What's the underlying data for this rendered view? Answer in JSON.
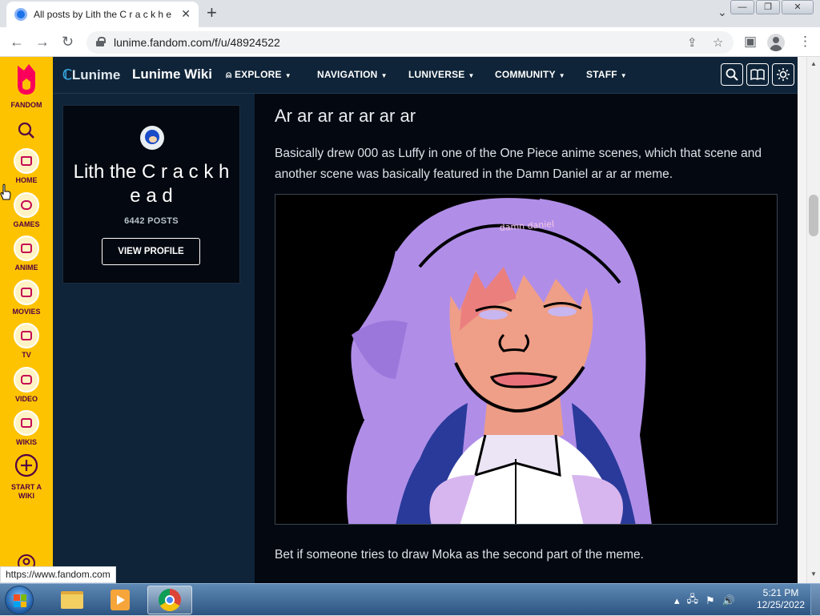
{
  "browser": {
    "tab_title": "All posts by Lith the C r a c k h e",
    "tab_close": "✕",
    "new_tab": "+",
    "url": "lunime.fandom.com/f/u/48924522",
    "status_url": "https://www.fandom.com"
  },
  "window_controls": {
    "minimize": "—",
    "restore": "❐",
    "close": "✕"
  },
  "fandom_rail": {
    "brand": "FANDOM",
    "items": [
      {
        "label": "HOME"
      },
      {
        "label": "GAMES"
      },
      {
        "label": "ANIME"
      },
      {
        "label": "MOVIES"
      },
      {
        "label": "TV"
      },
      {
        "label": "VIDEO"
      },
      {
        "label": "WIKIS"
      },
      {
        "label": "START A WIKI"
      }
    ]
  },
  "wiki_header": {
    "logo": "Lunime",
    "wiki_name": "Lunime Wiki",
    "nav": [
      "EXPLORE",
      "NAVIGATION",
      "LUNIVERSE",
      "COMMUNITY",
      "STAFF"
    ]
  },
  "profile": {
    "name": "Lith the C r a c k h e a d",
    "posts": "6442 POSTS",
    "button": "VIEW PROFILE"
  },
  "post": {
    "title": "Ar ar ar ar ar ar ar",
    "body": "Basically drew 000 as Luffy in one of the One Piece anime scenes, which that scene and another scene was basically featured in the Damn Daniel ar ar ar meme.",
    "image_text": "damn daniel",
    "footer": "Bet if someone tries to draw Moka as the second part of the meme."
  },
  "taskbar": {
    "time": "5:21 PM",
    "date": "12/25/2022"
  },
  "colors": {
    "fandom_yellow": "#fec300",
    "wiki_bg": "#0f2438",
    "content_bg": "#040810",
    "hair": "#b08ee8"
  }
}
